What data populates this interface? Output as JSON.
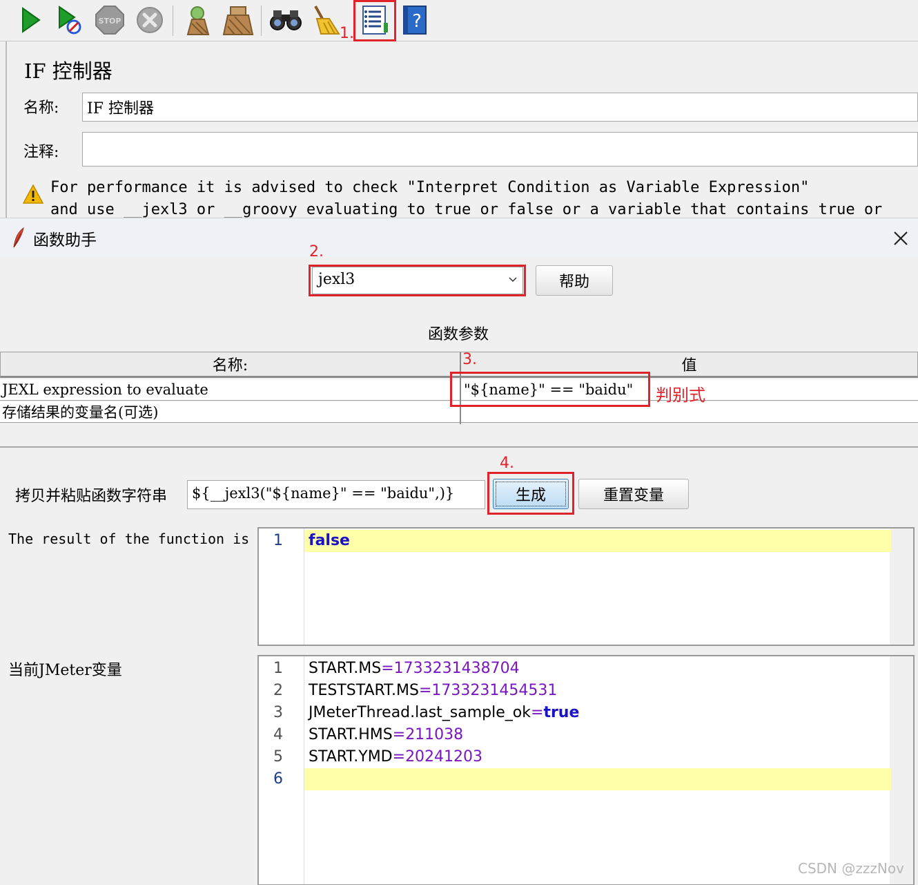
{
  "toolbar": {
    "buttons": [
      {
        "name": "start-icon"
      },
      {
        "name": "start-no-pauses-icon"
      },
      {
        "name": "stop-icon"
      },
      {
        "name": "shutdown-icon"
      },
      {
        "name": "clear-icon"
      },
      {
        "name": "clear-all-icon"
      },
      {
        "name": "search-icon"
      },
      {
        "name": "reset-search-icon"
      },
      {
        "name": "function-helper-icon"
      },
      {
        "name": "help-icon"
      }
    ],
    "annotation_1": "1."
  },
  "if_controller": {
    "title": "IF 控制器",
    "name_label": "名称:",
    "name_value": "IF 控制器",
    "comment_label": "注释:",
    "comment_value": "",
    "warning_line1": "For performance it is advised to check \"Interpret Condition as Variable Expression\"",
    "warning_line2": "and use __jexl3 or __groovy evaluating to true or false or a variable that contains true or"
  },
  "function_helper": {
    "title": "函数助手",
    "annotation_2": "2.",
    "function_select": "jexl3",
    "help_button": "帮助",
    "params_title": "函数参数",
    "table": {
      "col_name": "名称:",
      "col_value": "值",
      "annotation_3": "3.",
      "rows": [
        {
          "name": "JEXL expression to evaluate",
          "value": "\"${name}\" == \"baidu\""
        },
        {
          "name": "存储结果的变量名(可选)",
          "value": ""
        }
      ],
      "side_note": "判别式"
    },
    "copy_label": "拷贝并粘贴函数字符串",
    "copy_value": "${__jexl3(\"${name}\" == \"baidu\",)}",
    "annotation_4": "4.",
    "generate_button": "生成",
    "reset_button": "重置变量",
    "result_label": "The result of the function is",
    "result_lines": [
      {
        "no": "1",
        "text": "false"
      }
    ],
    "vars_label": "当前JMeter变量",
    "var_lines": [
      {
        "no": "1",
        "key": "START.MS",
        "eq": "=",
        "val": "1733231438704"
      },
      {
        "no": "2",
        "key": "TESTSTART.MS",
        "eq": "=",
        "val": "1733231454531"
      },
      {
        "no": "3",
        "key": "JMeterThread.last_sample_ok",
        "eq": "=",
        "val": "true"
      },
      {
        "no": "4",
        "key": "START.HMS",
        "eq": "=",
        "val": "211038"
      },
      {
        "no": "5",
        "key": "START.YMD",
        "eq": "=",
        "val": "20241203"
      },
      {
        "no": "6",
        "key": "",
        "eq": "",
        "val": ""
      }
    ]
  },
  "watermark": "CSDN @zzzNov",
  "colors": {
    "annotation_red": "#e0232b",
    "keyword_blue": "#1a12c7",
    "value_purple": "#7a16c0",
    "highlight_yellow": "#ffffaa"
  }
}
